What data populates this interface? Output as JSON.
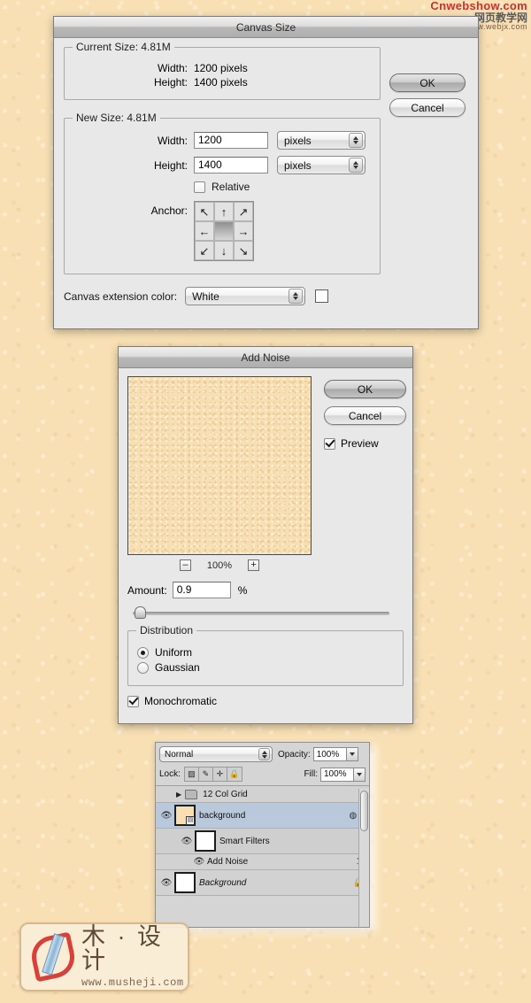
{
  "watermarks": {
    "top": {
      "line1": "Cnwebshow.com",
      "line2": "网页教学网",
      "line3": "www.webjx.com"
    },
    "bottom": {
      "brand": "木 · 设计",
      "url": "www.musheji.com"
    }
  },
  "canvas_size": {
    "title": "Canvas Size",
    "current_size": {
      "legend": "Current Size: 4.81M",
      "width_label": "Width:",
      "width_value": "1200 pixels",
      "height_label": "Height:",
      "height_value": "1400 pixels"
    },
    "new_size": {
      "legend": "New Size: 4.81M",
      "width_label": "Width:",
      "width_value": "1200",
      "width_unit": "pixels",
      "height_label": "Height:",
      "height_value": "1400",
      "height_unit": "pixels",
      "relative_label": "Relative",
      "relative_checked": false,
      "anchor_label": "Anchor:",
      "anchor_arrows": [
        "↖",
        "↑",
        "↗",
        "←",
        "",
        "→",
        "↙",
        "↓",
        "↘"
      ],
      "anchor_selected_index": 4
    },
    "extension": {
      "label": "Canvas extension color:",
      "value": "White",
      "swatch_color": "#ffffff"
    },
    "buttons": {
      "ok": "OK",
      "cancel": "Cancel"
    }
  },
  "add_noise": {
    "title": "Add Noise",
    "buttons": {
      "ok": "OK",
      "cancel": "Cancel"
    },
    "preview_label": "Preview",
    "preview_checked": true,
    "preview_color": "#f8dfb2",
    "zoom": {
      "minus": "–",
      "percent": "100%",
      "plus": "+"
    },
    "amount": {
      "label": "Amount:",
      "value": "0.9",
      "unit": "%",
      "slider_position_pct": 3
    },
    "distribution": {
      "legend": "Distribution",
      "options": [
        "Uniform",
        "Gaussian"
      ],
      "selected": "Uniform"
    },
    "monochromatic": {
      "label": "Monochromatic",
      "checked": true
    }
  },
  "layers_panel": {
    "blend_mode": "Normal",
    "opacity_label": "Opacity:",
    "opacity_value": "100%",
    "lock_label": "Lock:",
    "lock_icons": [
      "lock-transparency",
      "lock-image",
      "lock-position",
      "lock-all"
    ],
    "fill_label": "Fill:",
    "fill_value": "100%",
    "rows": [
      {
        "name": "12 Col Grid",
        "type": "group",
        "visible": false,
        "selected": false
      },
      {
        "name": "background",
        "type": "smart-object",
        "visible": true,
        "selected": true,
        "thumb_color": "#f8dfb2"
      },
      {
        "name": "Smart Filters",
        "type": "smart-filters",
        "visible": true,
        "selected": false
      },
      {
        "name": "Add Noise",
        "type": "filter",
        "visible": true,
        "selected": false
      },
      {
        "name": "Background",
        "type": "background",
        "visible": true,
        "selected": false,
        "italic": true,
        "locked": true
      }
    ]
  }
}
